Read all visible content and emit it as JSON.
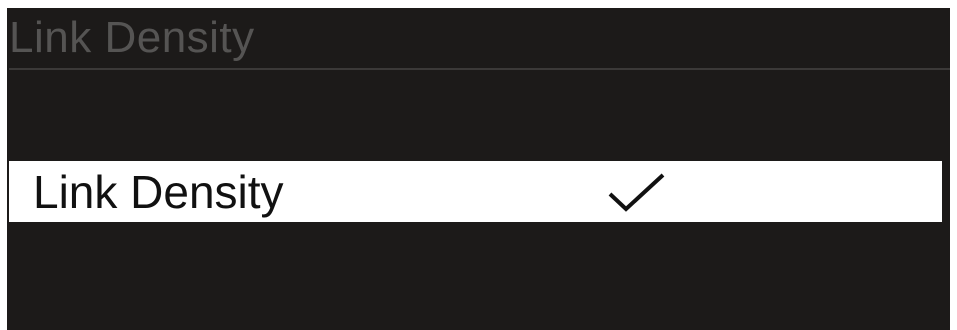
{
  "screen": {
    "title": "Link Density",
    "background_color": "#1c1a19"
  },
  "menu": {
    "items": [
      {
        "label": "Link Density",
        "selected": true,
        "icon": "checkmark-icon"
      }
    ]
  }
}
